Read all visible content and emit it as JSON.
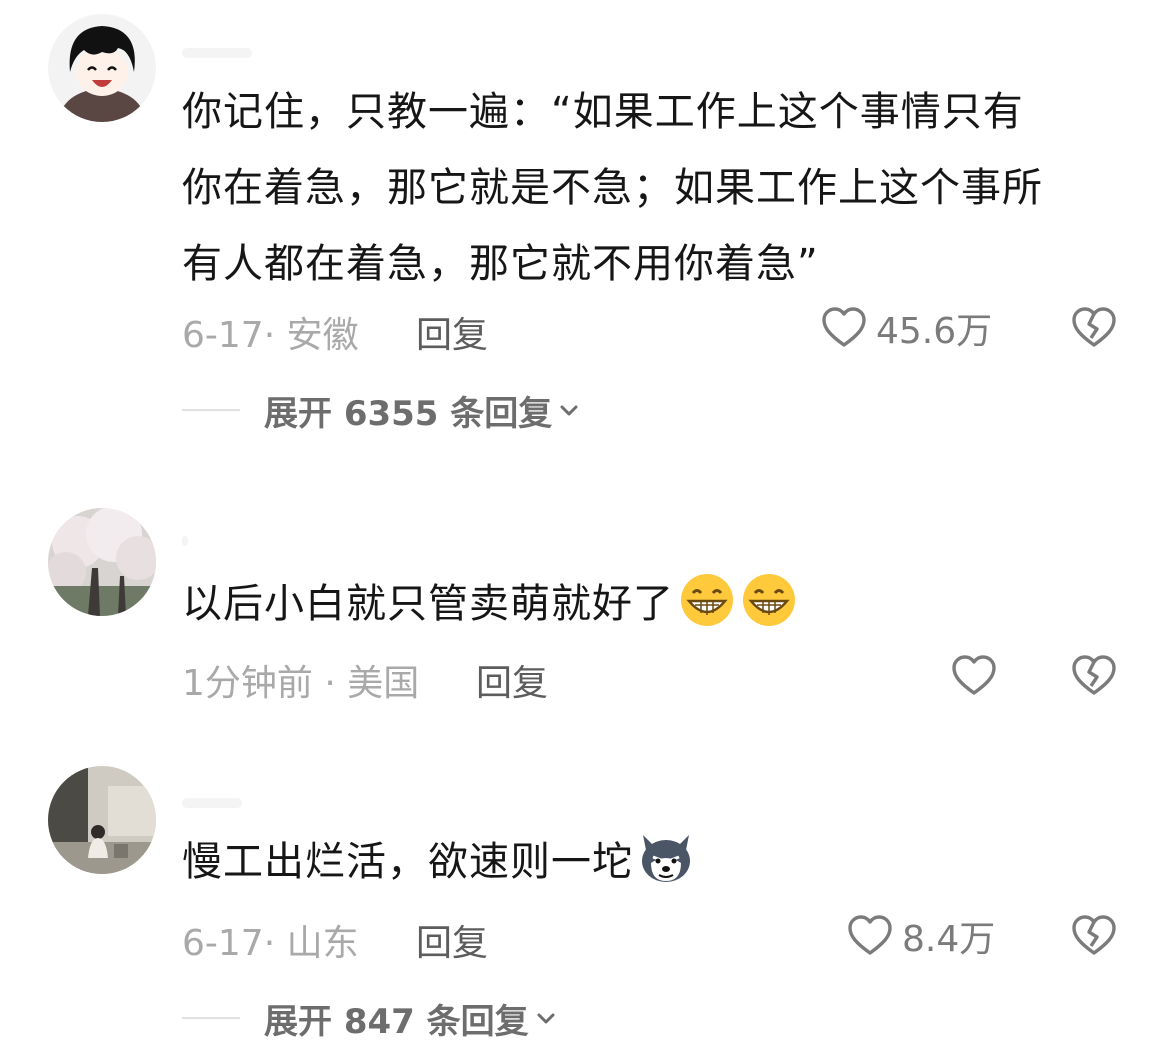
{
  "colors": {
    "text": "#161616",
    "meta": "#a9a9a9",
    "reply": "#5c5c5c",
    "icon": "#7b7b7b",
    "expand": "#6d6d6d"
  },
  "comments": [
    {
      "avatar": "cartoon-boy-avatar",
      "text_lines": [
        "你记住，只教一遍：“如果工作上这个事情只有",
        "你在着急，那它就是不急；如果工作上这个事所",
        "有人都在着急，那它就不用你着急”"
      ],
      "meta": "6-17· 安徽",
      "reply_label": "回复",
      "likes": "45.6万",
      "expand_label": "展开 6355 条回复"
    },
    {
      "avatar": "cherry-blossom-avatar",
      "text": "以后小白就只管卖萌就好了",
      "emoji": [
        "grinning-emoji",
        "grinning-emoji"
      ],
      "meta": "1分钟前 · 美国",
      "reply_label": "回复",
      "likes": ""
    },
    {
      "avatar": "person-sitting-avatar",
      "text": "慢工出烂活，欲速则一坨",
      "emoji": [
        "husky-dog-emoji"
      ],
      "meta": "6-17· 山东",
      "reply_label": "回复",
      "likes": "8.4万",
      "expand_label": "展开 847 条回复"
    }
  ]
}
